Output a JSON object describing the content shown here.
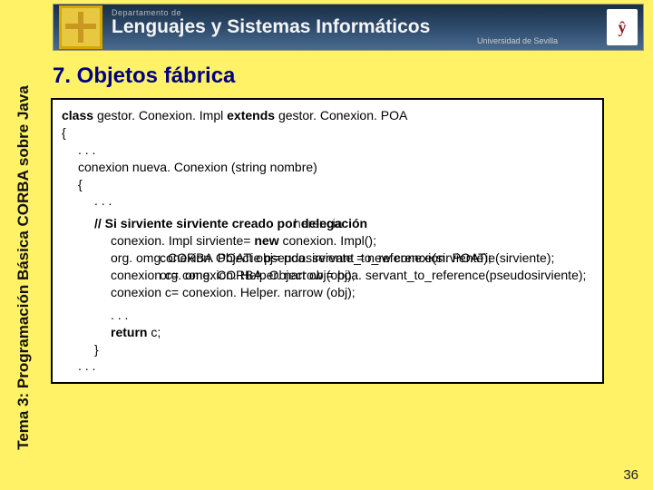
{
  "banner": {
    "dept": "Departamento de",
    "main": "Lenguajes y Sistemas Informáticos",
    "uni": "Universidad de Sevilla",
    "crest": "ŷ"
  },
  "sidebar": {
    "label": "Tema 3: Programación Básica CORBA sobre Java"
  },
  "heading": "7. Objetos fábrica",
  "code": {
    "l1a": "class ",
    "l1b": "gestor. Conexion. Impl ",
    "l1c": "extends ",
    "l1d": "gestor. Conexion. POA",
    "l2": "{",
    "l3": ". . .",
    "l4": "conexion nueva. Conexion (string nombre)",
    "l5": "{",
    "l6": ". . .",
    "l7_comment": "// Si sirviente sirviente creado por delegación",
    "l7_overlay_word": "herencia",
    "l8a": "conexion. Impl sirviente= ",
    "l8b": "new ",
    "l8c": "conexion. Impl();",
    "l9_a": "org. omg. CORBA Object obj= poa. servant_to_reference(sirviente);",
    "l9_b": "conexion. POATie pseudosirviente = new conexion. POATie(sirviente);",
    "l10_a": "conexion c= conexion. Helper. narrow (obj);",
    "l10_b": "org. omg. CORBA. Object obj= poa. servant_to_reference(pseudosirviente);",
    "l11": "conexion c= conexion. Helper. narrow (obj);",
    "l12": ". . .",
    "l13a": "return ",
    "l13b": "c;",
    "l14": "}",
    "l15": ". . ."
  },
  "pagenum": "36"
}
